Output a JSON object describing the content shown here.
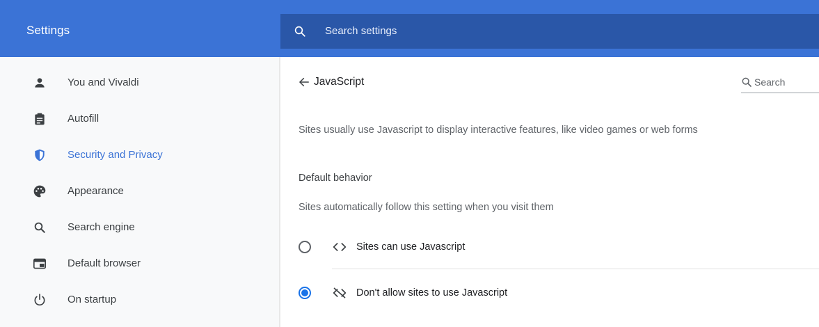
{
  "header": {
    "title": "Settings",
    "search_placeholder": "Search settings"
  },
  "sidebar": {
    "items": [
      {
        "label": "You and Vivaldi",
        "icon": "person-icon",
        "active": false
      },
      {
        "label": "Autofill",
        "icon": "clipboard-icon",
        "active": false
      },
      {
        "label": "Security and Privacy",
        "icon": "shield-icon",
        "active": true
      },
      {
        "label": "Appearance",
        "icon": "palette-icon",
        "active": false
      },
      {
        "label": "Search engine",
        "icon": "search-icon",
        "active": false
      },
      {
        "label": "Default browser",
        "icon": "browser-window-icon",
        "active": false
      },
      {
        "label": "On startup",
        "icon": "power-icon",
        "active": false
      }
    ]
  },
  "main": {
    "title": "JavaScript",
    "search_placeholder": "Search",
    "description": "Sites usually use Javascript to display interactive features, like video games or web forms",
    "section_heading": "Default behavior",
    "section_sub": "Sites automatically follow this setting when you visit them",
    "options": [
      {
        "label": "Sites can use Javascript",
        "icon": "code-icon",
        "selected": false
      },
      {
        "label": "Don't allow sites to use Javascript",
        "icon": "code-off-icon",
        "selected": true
      }
    ]
  },
  "colors": {
    "header_bg": "#3b73d6",
    "search_bg": "#2a57a8",
    "accent": "#1a73e8",
    "sidebar_bg": "#f8f9fa"
  }
}
